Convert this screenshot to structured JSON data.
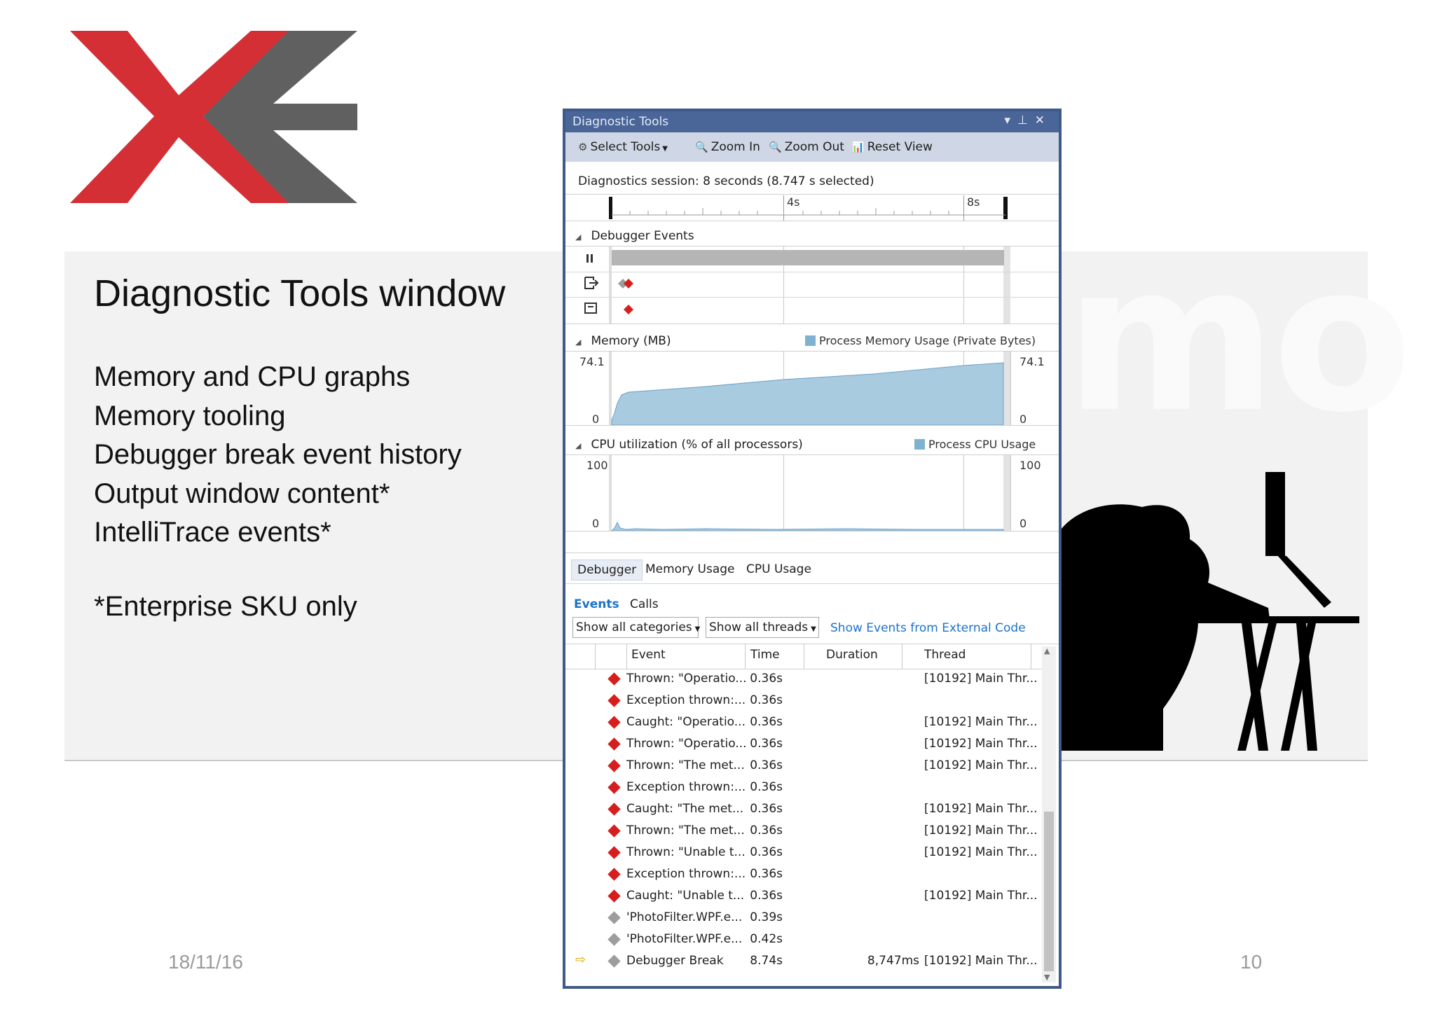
{
  "slide": {
    "title": "Diagnostic Tools window",
    "bullets": [
      "Memory and CPU graphs",
      "Memory tooling",
      "Debugger break event history",
      "Output window content*",
      "IntelliTrace events*"
    ],
    "footnote": "*Enterprise SKU only",
    "date": "18/11/16",
    "page_number": "10",
    "watermark": "mo",
    "colors": {
      "logo_red": "#d42f35",
      "logo_gray": "#606060",
      "band": "#f2f2f2"
    }
  },
  "window": {
    "title": "Diagnostic Tools",
    "controls": [
      "▾",
      "⊥",
      "✕"
    ],
    "toolbar": [
      {
        "icon": "gear-icon",
        "label": "Select Tools",
        "dropdown": true
      },
      {
        "icon": "zoom-in-icon",
        "label": "Zoom In"
      },
      {
        "icon": "zoom-out-icon",
        "label": "Zoom Out"
      },
      {
        "icon": "reset-view-icon",
        "label": "Reset View"
      }
    ],
    "session": "Diagnostics session: 8 seconds (8.747 s selected)",
    "ruler_labels": [
      "4s",
      "8s"
    ],
    "debugger_events": {
      "title": "Debugger Events"
    },
    "memory": {
      "title": "Memory (MB)",
      "legend": "Process Memory Usage (Private Bytes)",
      "max": "74.1",
      "min": "0"
    },
    "cpu": {
      "title": "CPU utilization (% of all processors)",
      "legend": "Process CPU Usage",
      "max": "100",
      "min": "0"
    },
    "tabs": [
      "Debugger",
      "Memory Usage",
      "CPU Usage"
    ],
    "subtabs": [
      "Events",
      "Calls"
    ],
    "filters": {
      "category": "Show all categories",
      "threads": "Show all threads",
      "external_link": "Show Events from External Code"
    },
    "columns": [
      "Event",
      "Time",
      "Duration",
      "Thread"
    ],
    "events": [
      {
        "icon": "red",
        "event": "Thrown: \"Operatio...",
        "time": "0.36s",
        "duration": "",
        "thread": "[10192] Main Thr..."
      },
      {
        "icon": "red",
        "event": "Exception thrown:...",
        "time": "0.36s",
        "duration": "",
        "thread": ""
      },
      {
        "icon": "red",
        "event": "Caught: \"Operatio...",
        "time": "0.36s",
        "duration": "",
        "thread": "[10192] Main Thr..."
      },
      {
        "icon": "red",
        "event": "Thrown: \"Operatio...",
        "time": "0.36s",
        "duration": "",
        "thread": "[10192] Main Thr..."
      },
      {
        "icon": "red",
        "event": "Thrown: \"The met...",
        "time": "0.36s",
        "duration": "",
        "thread": "[10192] Main Thr..."
      },
      {
        "icon": "red",
        "event": "Exception thrown:...",
        "time": "0.36s",
        "duration": "",
        "thread": ""
      },
      {
        "icon": "red",
        "event": "Caught: \"The met...",
        "time": "0.36s",
        "duration": "",
        "thread": "[10192] Main Thr..."
      },
      {
        "icon": "red",
        "event": "Thrown: \"The met...",
        "time": "0.36s",
        "duration": "",
        "thread": "[10192] Main Thr..."
      },
      {
        "icon": "red",
        "event": "Thrown: \"Unable t...",
        "time": "0.36s",
        "duration": "",
        "thread": "[10192] Main Thr..."
      },
      {
        "icon": "red",
        "event": "Exception thrown:...",
        "time": "0.36s",
        "duration": "",
        "thread": ""
      },
      {
        "icon": "red",
        "event": "Caught: \"Unable t...",
        "time": "0.36s",
        "duration": "",
        "thread": "[10192] Main Thr..."
      },
      {
        "icon": "gray",
        "event": "'PhotoFilter.WPF.e...",
        "time": "0.39s",
        "duration": "",
        "thread": ""
      },
      {
        "icon": "gray",
        "event": "'PhotoFilter.WPF.e...",
        "time": "0.42s",
        "duration": "",
        "thread": ""
      },
      {
        "icon": "gray",
        "event": "Debugger Break",
        "time": "8.74s",
        "duration": "8,747ms",
        "thread": "[10192] Main Thr...",
        "current": true
      }
    ]
  }
}
